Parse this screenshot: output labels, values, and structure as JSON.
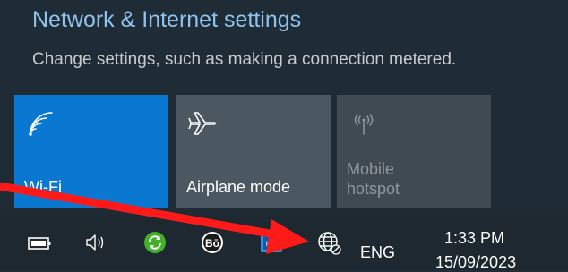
{
  "flyout": {
    "title": "Network & Internet settings",
    "subtitle": "Change settings, such as making a connection metered."
  },
  "tiles": [
    {
      "label": "Wi-Fi",
      "icon": "wifi-icon",
      "state": "on",
      "color": "#0a77d1"
    },
    {
      "label": "Airplane mode",
      "icon": "airplane-icon",
      "state": "off",
      "color": "#4b5761"
    },
    {
      "label_line1": "Mobile",
      "label_line2": "hotspot",
      "icon": "mobile-hotspot-icon",
      "state": "disabled",
      "color": "#3f4a53"
    }
  ],
  "taskbar": {
    "icons": [
      "battery-icon",
      "volume-icon",
      "sync-icon",
      "beats-audio-icon",
      "intel-graphics-icon",
      "network-globe-icon"
    ],
    "language": "ENG",
    "time": "1:33 PM",
    "date": "15/09/2023"
  },
  "annotation": {
    "arrow_color": "#ff1a1a",
    "points_to": "network-globe-icon"
  }
}
